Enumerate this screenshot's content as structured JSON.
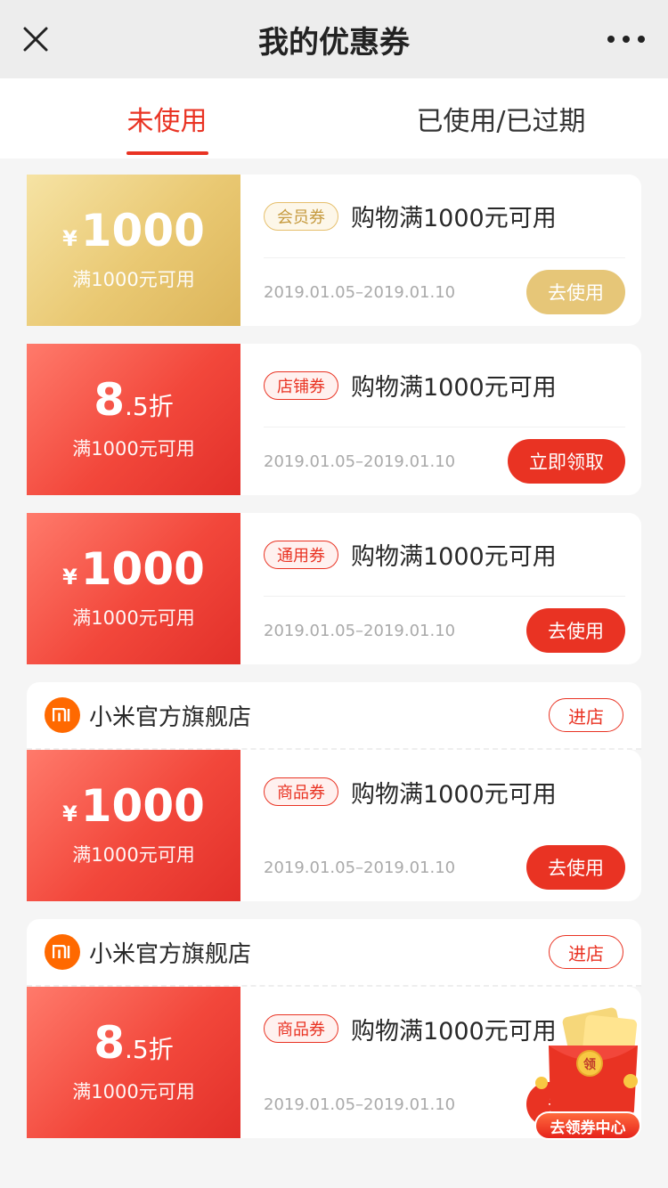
{
  "nav": {
    "title": "我的优惠券"
  },
  "tabs": [
    {
      "label": "未使用",
      "active": true
    },
    {
      "label": "已使用/已过期",
      "active": false
    }
  ],
  "coupons": [
    {
      "currency": "¥",
      "amount": "1000",
      "condition": "满1000元可用",
      "badge": "会员券",
      "title": "购物满1000元可用",
      "date": "2019.01.05–2019.01.10",
      "button": "去使用",
      "theme": "gold"
    },
    {
      "amount_main": "8",
      "amount_small": ".5折",
      "condition": "满1000元可用",
      "badge": "店铺券",
      "title": "购物满1000元可用",
      "date": "2019.01.05–2019.01.10",
      "button": "立即领取",
      "theme": "red"
    },
    {
      "currency": "¥",
      "amount": "1000",
      "condition": "满1000元可用",
      "badge": "通用券",
      "title": "购物满1000元可用",
      "date": "2019.01.05–2019.01.10",
      "button": "去使用",
      "theme": "red"
    },
    {
      "currency": "¥",
      "amount": "1000",
      "condition": "满1000元可用",
      "badge": "商品券",
      "title": "购物满1000元可用",
      "date": "2019.01.05–2019.01.10",
      "button": "去使用",
      "theme": "red"
    },
    {
      "amount_main": "8",
      "amount_small": ".5折",
      "condition": "满1000元可用",
      "badge": "商品券",
      "title": "购物满1000元可用",
      "date": "2019.01.05–2019.01.10",
      "button": "去使用",
      "theme": "red"
    }
  ],
  "stores": [
    {
      "logo": "mi",
      "name": "小米官方旗舰店",
      "button": "进店"
    },
    {
      "logo": "mi",
      "name": "小米官方旗舰店",
      "button": "进店"
    }
  ],
  "floating": {
    "label": "去领券中心",
    "badge_char": "领"
  },
  "colors": {
    "accent": "#e93323",
    "gold": "#e6c678",
    "store_logo": "#ff6900"
  }
}
